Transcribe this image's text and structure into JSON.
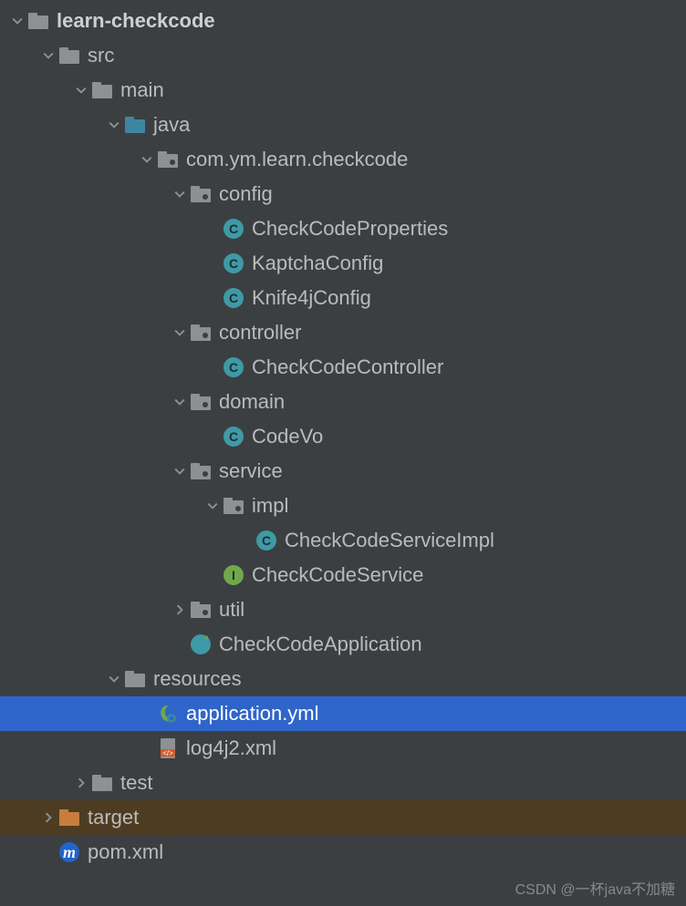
{
  "watermark": "CSDN @一杯java不加糖",
  "tree": {
    "root": "learn-checkcode",
    "src": "src",
    "main": "main",
    "java": "java",
    "pkg": "com.ym.learn.checkcode",
    "config": "config",
    "check_props": "CheckCodeProperties",
    "kaptcha": "KaptchaConfig",
    "knife": "Knife4jConfig",
    "controller": "controller",
    "controller_cls": "CheckCodeController",
    "domain": "domain",
    "codevo": "CodeVo",
    "service": "service",
    "impl": "impl",
    "service_impl": "CheckCodeServiceImpl",
    "service_if": "CheckCodeService",
    "util": "util",
    "app": "CheckCodeApplication",
    "resources": "resources",
    "app_yml": "application.yml",
    "log4j": "log4j2.xml",
    "test": "test",
    "target": "target",
    "pom": "pom.xml"
  }
}
